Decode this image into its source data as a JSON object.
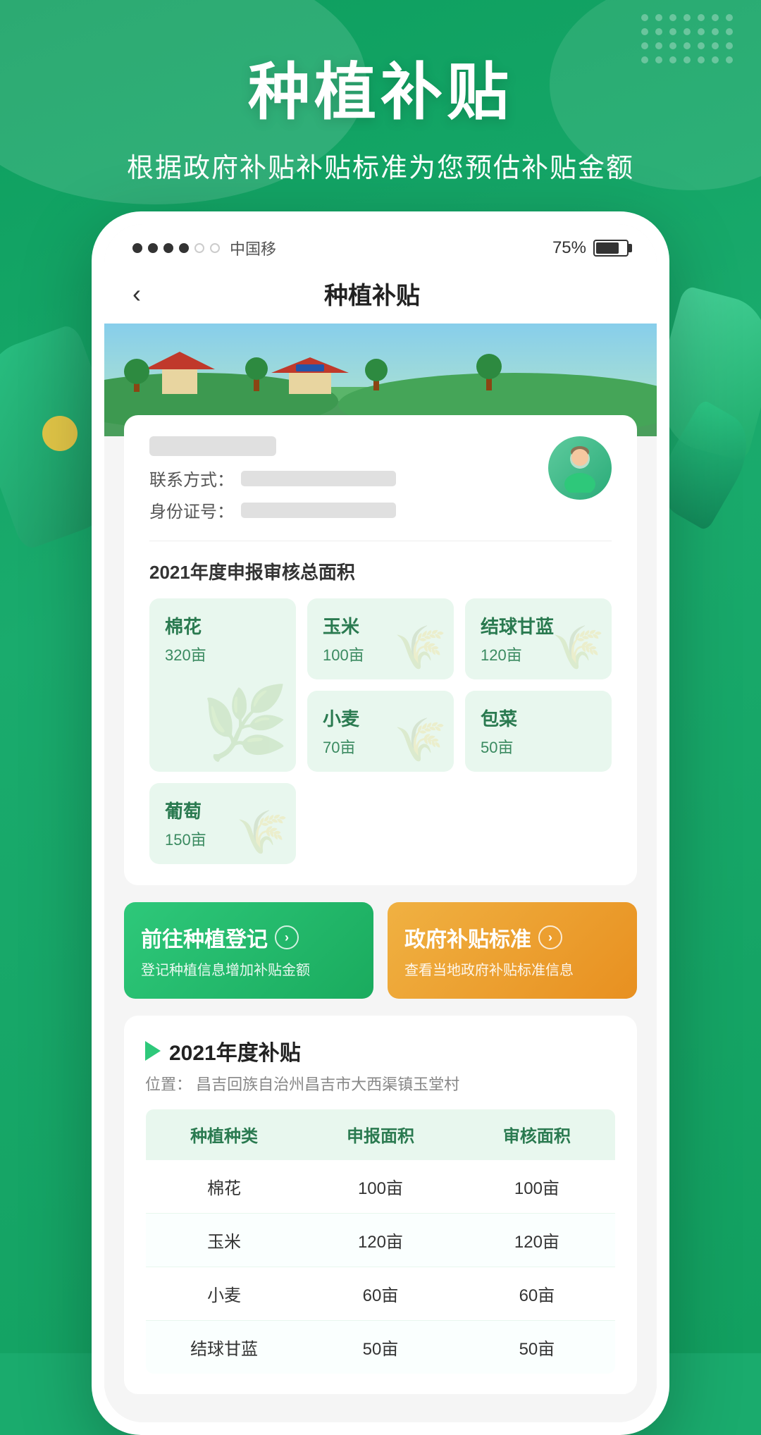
{
  "app": {
    "status_bar": {
      "carrier": "中国移",
      "dots": [
        "filled",
        "filled",
        "filled",
        "filled",
        "hollow",
        "hollow"
      ],
      "battery_percent": "75%"
    },
    "nav": {
      "back_label": "‹",
      "title": "种植补贴"
    }
  },
  "header": {
    "main_title": "种植补贴",
    "sub_title": "根据政府补贴补贴标准为您预估补贴金额"
  },
  "user_card": {
    "contact_label": "联系方式：",
    "id_label": "身份证号："
  },
  "stats": {
    "section_title": "2021年度申报审核总面积",
    "crops": [
      {
        "name": "棉花",
        "amount": "320亩",
        "large": true
      },
      {
        "name": "玉米",
        "amount": "100亩",
        "large": false
      },
      {
        "name": "结球甘蓝",
        "amount": "120亩",
        "large": false
      },
      {
        "name": "小麦",
        "amount": "70亩",
        "large": false
      },
      {
        "name": "包菜",
        "amount": "50亩",
        "large": false
      },
      {
        "name": "葡萄",
        "amount": "150亩",
        "large": false
      }
    ]
  },
  "actions": {
    "register": {
      "title": "前往种植登记",
      "subtitle": "登记种植信息增加补贴金额",
      "arrow": "›"
    },
    "standard": {
      "title": "政府补贴标准",
      "subtitle": "查看当地政府补贴标准信息",
      "arrow": "›"
    }
  },
  "subsidy": {
    "year_label": "2021年度补贴",
    "location_prefix": "位置：",
    "location": "昌吉回族自治州昌吉市大西渠镇玉堂村",
    "table": {
      "headers": [
        "种植种类",
        "申报面积",
        "审核面积"
      ],
      "rows": [
        {
          "crop": "棉花",
          "declared": "100亩",
          "reviewed": "100亩"
        },
        {
          "crop": "玉米",
          "declared": "120亩",
          "reviewed": "120亩"
        },
        {
          "crop": "小麦",
          "declared": "60亩",
          "reviewed": "60亩"
        },
        {
          "crop": "结球甘蓝",
          "declared": "50亩",
          "reviewed": "50亩"
        }
      ]
    }
  }
}
